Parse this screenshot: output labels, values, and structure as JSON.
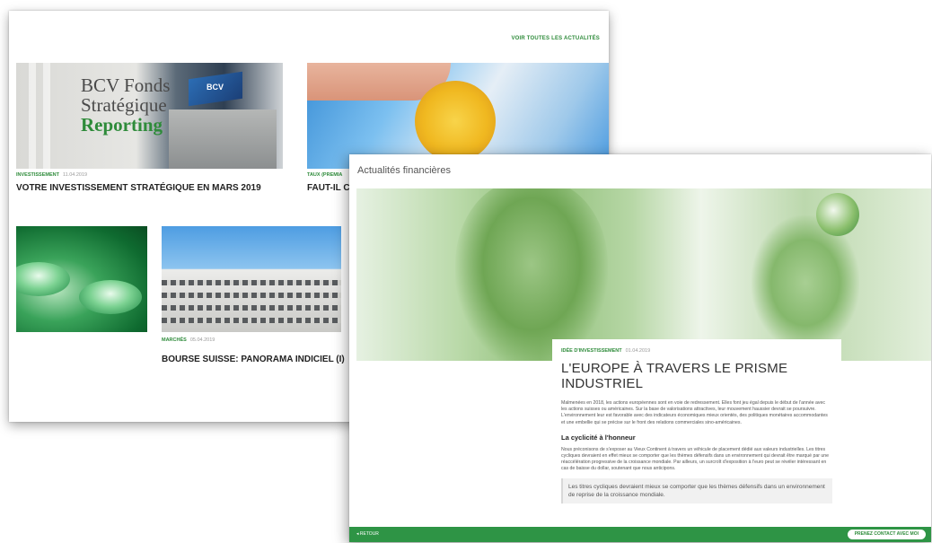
{
  "back_page": {
    "see_all_link": "VOIR TOUTES LES ACTUALITÉS",
    "tiles": {
      "bcv": {
        "line1": "BCV Fonds",
        "line2": "Stratégique",
        "line3": "Reporting",
        "sign": "BCV"
      }
    },
    "articles": [
      {
        "category": "INVESTISSEMENT",
        "date": "11.04.2019",
        "title": "VOTRE INVESTISSEMENT STRATÉGIQUE EN MARS 2019"
      },
      {
        "category": "TAUX (PREMIA",
        "date": "",
        "title": "FAUT-IL C"
      },
      {
        "category": "MARCHÉS",
        "date": "05.04.2019",
        "title": "BOURSE SUISSE: PANORAMA INDICIEL (I)"
      }
    ]
  },
  "front_page": {
    "title": "Actualités financières",
    "article": {
      "category": "IDÉE D'INVESTISSEMENT",
      "date": "01.04.2019",
      "heading": "L'EUROPE À TRAVERS LE PRISME INDUSTRIEL",
      "paragraph1": "Malmenées en 2018, les actions européennes sont en voie de redressement. Elles font jeu égal depuis le début de l'année avec les actions suisses ou américaines. Sur la base de valorisations attractives, leur mouvement haussier devrait se poursuivre. L'environnement leur est favorable avec des indicateurs économiques mieux orientés, des politiques monétaires accommodantes et une embellie qui se précise sur le front des relations commerciales sino-américaines.",
      "subheading": "La cyclicité à l'honneur",
      "paragraph2": "Nous préconisons de s'exposer au Vieux Continent à travers un véhicule de placement dédié aux valeurs industrielles. Les titres cycliques devraient en effet mieux se comporter que les thèmes défensifs dans un environnement qui devrait être marqué par une réaccélération progressive de la croissance mondiale. Par ailleurs, un surcroît d'exposition à l'euro peut se révéler intéressant en cas de baisse du dollar, soutenant que nous anticipons.",
      "quote": "Les titres cycliques devraient mieux se comporter que les thèmes défensifs dans un environnement de reprise de la croissance mondiale."
    },
    "footer": {
      "back_label": "◂ RETOUR",
      "contact_button": "PRENEZ CONTACT AVEC MOI"
    }
  }
}
